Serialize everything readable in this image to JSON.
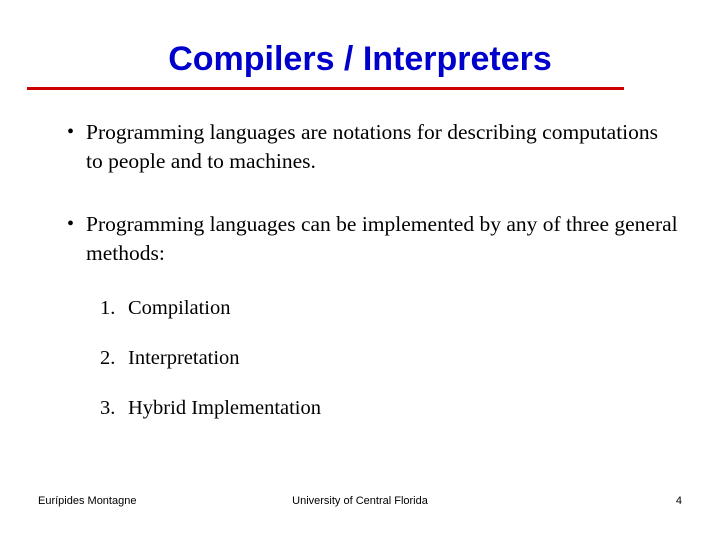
{
  "slide": {
    "title": "Compilers / Interpreters",
    "bullets": [
      {
        "marker": "•",
        "text": "Programming languages are notations for describing computations to people and to machines."
      },
      {
        "marker": "•",
        "text": "Programming languages can be implemented by any of three general methods:"
      }
    ],
    "numbered_items": [
      {
        "marker": "1.",
        "text": "Compilation"
      },
      {
        "marker": "2.",
        "text": "Interpretation"
      },
      {
        "marker": "3.",
        "text": "Hybrid Implementation"
      }
    ],
    "footer": {
      "left": "Eurípides Montagne",
      "center": "University of Central Florida",
      "right": "4"
    },
    "colors": {
      "title": "#0000cc",
      "rule": "#cc0000",
      "text": "#000000",
      "background": "#ffffff"
    }
  }
}
